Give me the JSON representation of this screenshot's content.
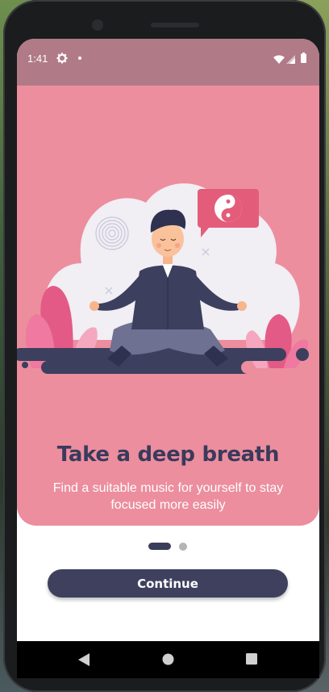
{
  "status_bar": {
    "time": "1:41",
    "icons": [
      "gear-icon",
      "notification-dot-icon",
      "wifi-icon",
      "cell-signal-icon",
      "battery-icon"
    ]
  },
  "onboarding": {
    "title": "Take a deep breath",
    "subtitle": "Find a suitable music for yourself to stay focused more easily",
    "illustration": "meditating-man-illustration",
    "page_indicator": {
      "current_page": 1,
      "total_pages": 2
    },
    "continue_label": "Continue"
  },
  "nav_bar": {
    "icons": [
      "back-icon",
      "home-icon",
      "recents-icon"
    ]
  },
  "colors": {
    "hero_background": "#ec8e9e",
    "status_bar": "#b07a86",
    "title": "#3a3a5c",
    "button": "#3e405e",
    "indicator_active": "#3b3e5a",
    "indicator_inactive": "#b5b5b5"
  }
}
